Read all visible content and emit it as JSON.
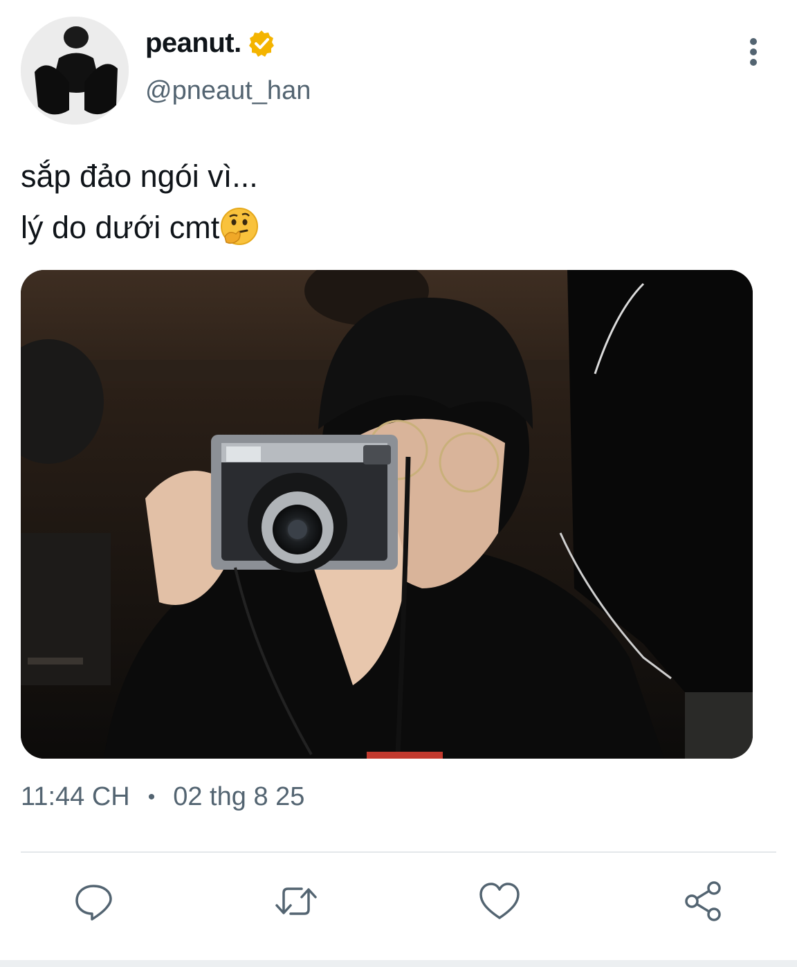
{
  "author": {
    "display_name": "peanut.",
    "handle": "@pneaut_han",
    "verified_badge_icon": "verified-badge-icon",
    "avatar_icon": "avatar-photo"
  },
  "tweet": {
    "lines": [
      "sắp đảo ngói vì...",
      "lý do dưới cmt"
    ],
    "emoji_icon": "thinking-face-icon",
    "media_icon": "photo-person-holding-instant-camera"
  },
  "meta": {
    "time": "11:44 CH",
    "separator": "•",
    "date": "02 thg 8 25"
  },
  "actions": [
    {
      "icon": "reply-icon"
    },
    {
      "icon": "retweet-icon"
    },
    {
      "icon": "like-icon"
    },
    {
      "icon": "share-icon"
    }
  ],
  "colors": {
    "text": "#0f1419",
    "secondary": "#536471",
    "badge": "#f4b400",
    "divider": "#e4e7ea"
  }
}
